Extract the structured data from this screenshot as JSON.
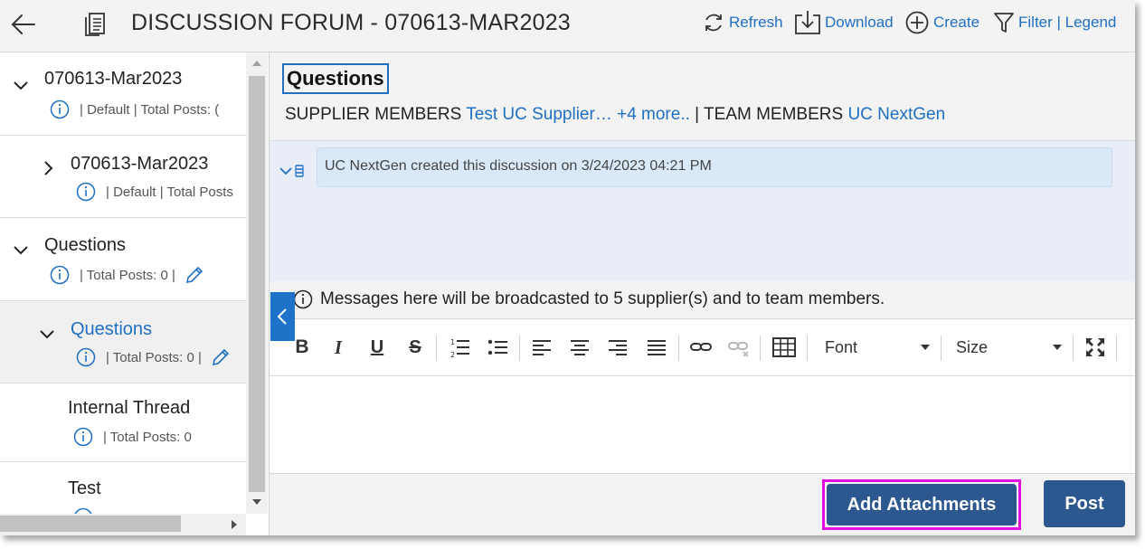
{
  "header": {
    "title": "DISCUSSION FORUM - 070613-MAR2023",
    "actions": {
      "refresh": "Refresh",
      "download": "Download",
      "create": "Create",
      "filter_legend": "Filter | Legend"
    }
  },
  "sidebar": {
    "items": [
      {
        "name": "070613-Mar2023",
        "meta": "| Default   |  Total Posts: ("
      },
      {
        "name": "070613-Mar2023",
        "meta": "| Default | Total Posts"
      },
      {
        "name": "Questions",
        "meta": "| Total Posts: 0   |"
      },
      {
        "name": "Questions",
        "meta": "| Total Posts: 0   |"
      },
      {
        "name": "Internal Thread",
        "meta": "| Total Posts: 0"
      },
      {
        "name": "Test",
        "meta": ""
      }
    ]
  },
  "main": {
    "topic_title": "Questions",
    "supplier_label": "SUPPLIER MEMBERS",
    "supplier_link": "Test UC Supplier… +4 more..",
    "team_label": "| TEAM MEMBERS",
    "team_link": "UC NextGen",
    "system_message": "UC NextGen created this discussion on 3/24/2023 04:21 PM",
    "broadcast_text": "Messages here will be broadcasted to 5 supplier(s) and to team members.",
    "editor": {
      "font_label": "Font",
      "size_label": "Size"
    },
    "buttons": {
      "add_attachments": "Add Attachments",
      "post": "Post"
    }
  },
  "colors": {
    "accent": "#1f6fc2",
    "button": "#2c578f",
    "highlight": "#e011e0"
  }
}
